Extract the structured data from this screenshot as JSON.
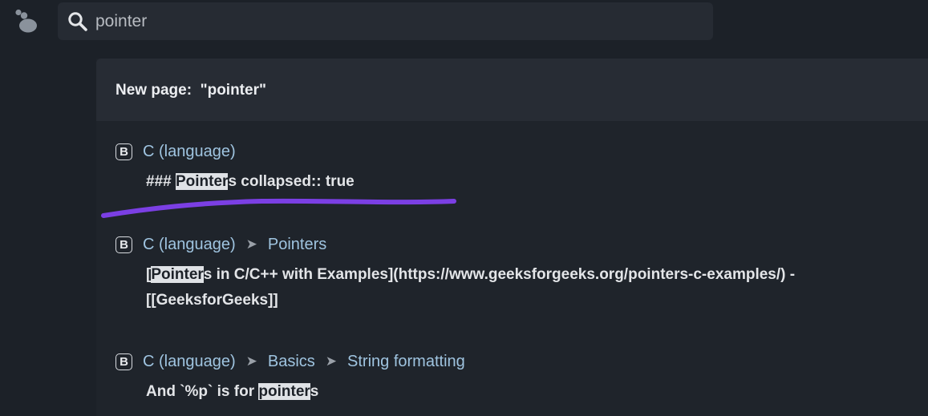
{
  "search": {
    "value": "pointer"
  },
  "new_page": {
    "label": "New page:  \"pointer\""
  },
  "results": [
    {
      "badge": "B",
      "crumbs": [
        "C (language)"
      ],
      "snippet_pre": "### ",
      "snippet_hl": "Pointer",
      "snippet_post": "s collapsed:: true"
    },
    {
      "badge": "B",
      "crumbs": [
        "C (language)",
        "Pointers"
      ],
      "snippet_pre": "[",
      "snippet_hl": "Pointer",
      "snippet_post": "s in C/C++ with Examples](https://www.geeksforgeeks.org/pointers-c-examples/) - [[GeeksforGeeks]]"
    },
    {
      "badge": "B",
      "crumbs": [
        "C (language)",
        "Basics",
        "String formatting"
      ],
      "snippet_pre": "And `%p` is for ",
      "snippet_hl": "pointer",
      "snippet_post": "s"
    }
  ],
  "separator_glyph": "➤",
  "colors": {
    "background": "#1c2128",
    "search_bg": "#262b33",
    "crumb_link": "#9fc4e0",
    "highlight": "#dfe2e6",
    "annotation_stroke": "#7b3fe4"
  }
}
